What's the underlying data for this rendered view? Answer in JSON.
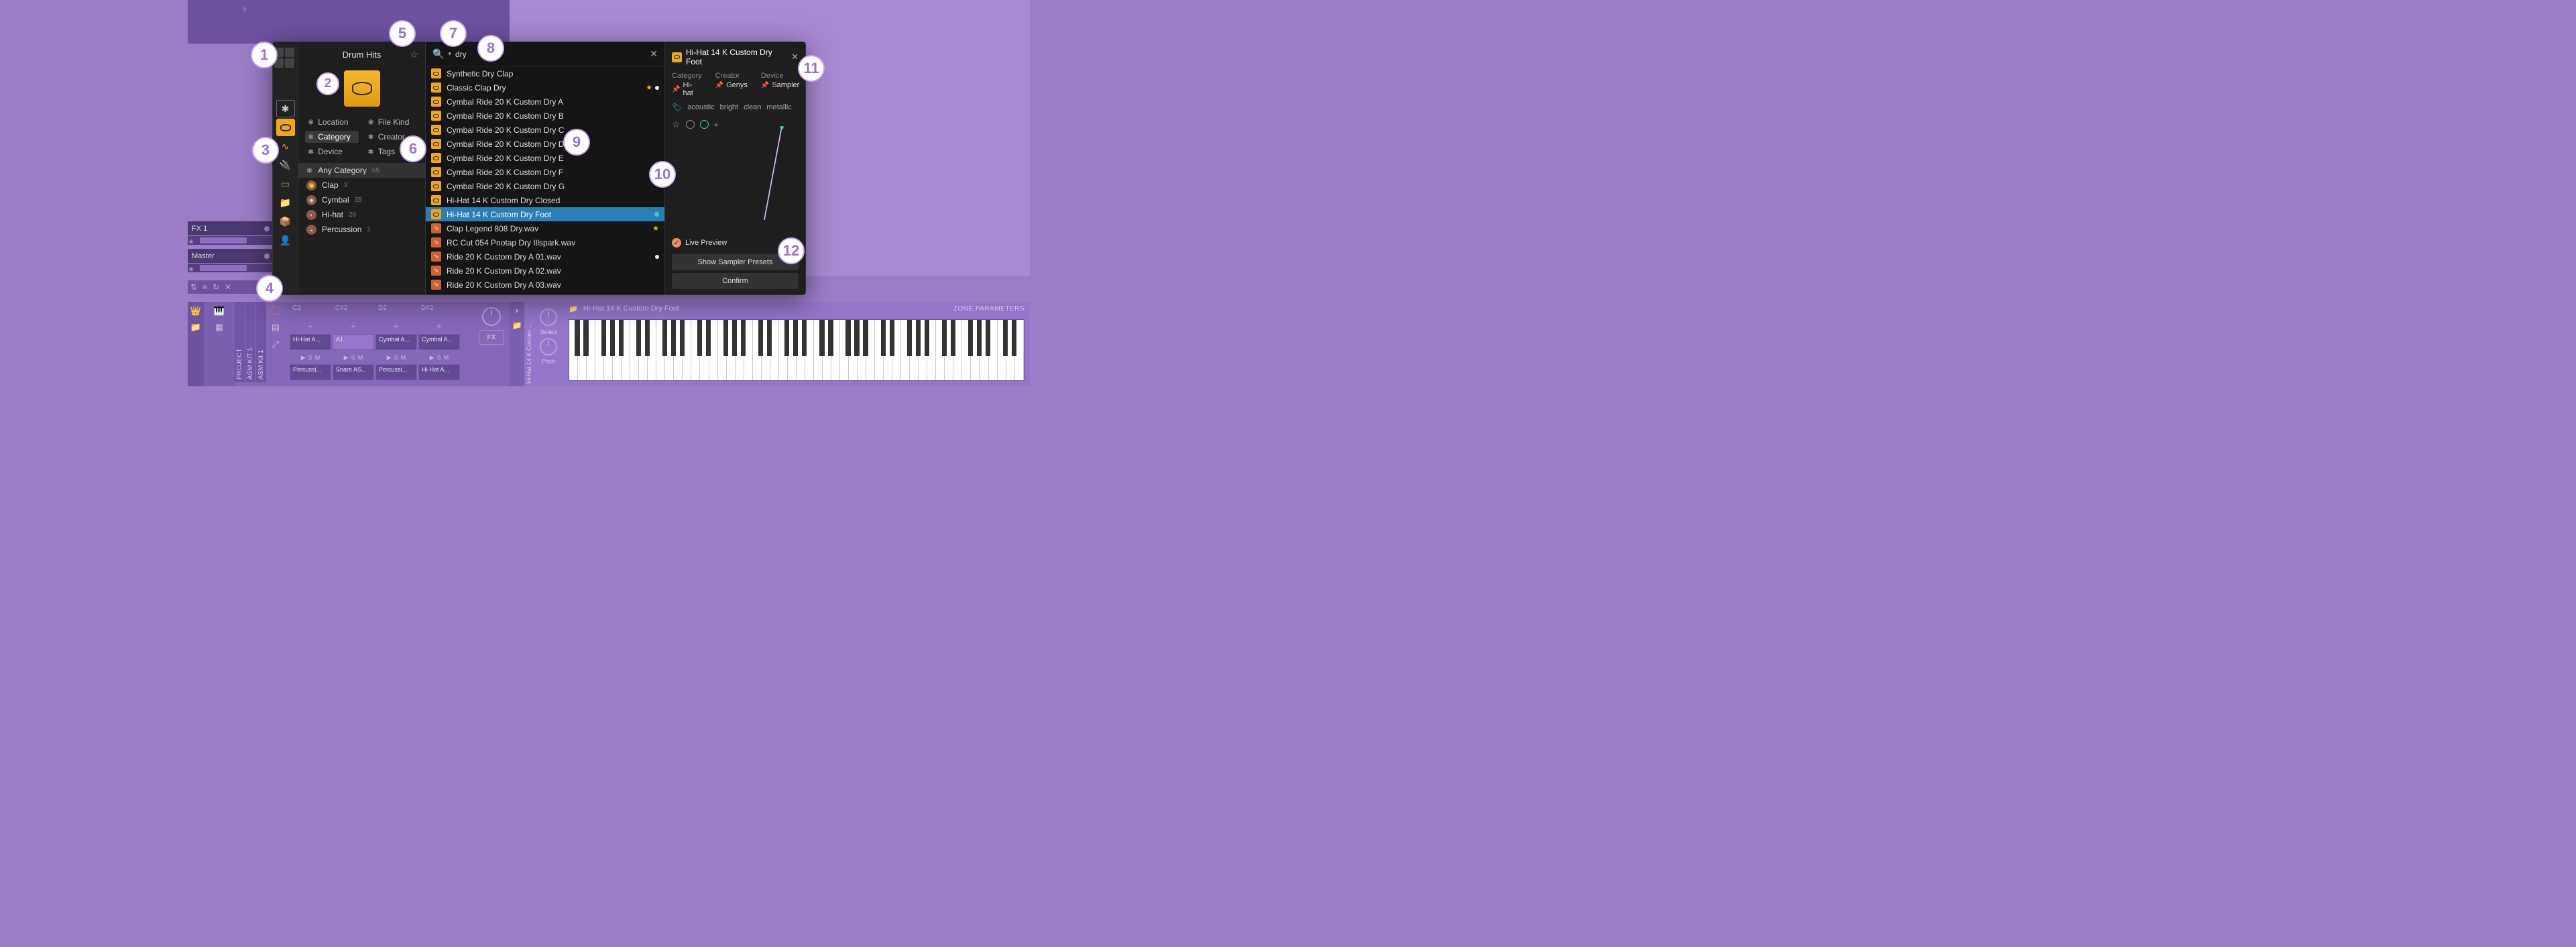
{
  "header": {
    "add_track_plus": "+"
  },
  "tracks": {
    "fx": {
      "name": "FX 1",
      "star": "★"
    },
    "master": {
      "name": "Master",
      "star": "★"
    }
  },
  "bottom_toolbar": {
    "icons": [
      "⇅",
      "≡",
      "↻",
      "✕"
    ],
    "chevron": "⌃"
  },
  "device_panel": {
    "vertical_labels": [
      "PROJECT",
      "ASM KIT 1",
      "ASM Kit 1"
    ],
    "power": "⏻",
    "pad_headers": [
      "C2",
      "C#2",
      "D2",
      "D#2"
    ],
    "pads_row1": [
      "Hi-Hat A...",
      "A1",
      "Cymbal A...",
      "Cymbal A..."
    ],
    "pads_row2": [
      "Percussi...",
      "Snare AS...",
      "Percussi...",
      "Hi-Hat A..."
    ],
    "pad_ctrl_play": "▶",
    "pad_ctrl_s": "S",
    "pad_ctrl_m": "M",
    "fx_label": "FX",
    "plus": "+"
  },
  "sampler": {
    "vlabel": "Hi-Hat 14 K Custom ...",
    "select_label": "Select",
    "pitch_label": "Pitch",
    "folder_icon": "📁",
    "file_name": "Hi-Hat 14 K Custom Dry Foot",
    "zone_params": "ZONE PARAMETERS",
    "half_moon": "◗"
  },
  "browser": {
    "title": "Drum Hits",
    "star": "☆",
    "strip_star": "✱",
    "filters": {
      "location": "Location",
      "file_kind": "File Kind",
      "category": "Category",
      "creator": "Creator",
      "device": "Device",
      "tags": "Tags"
    },
    "categories": {
      "any": "Any Category",
      "any_count": "65",
      "clap": "Clap",
      "clap_count": "3",
      "cymbal": "Cymbal",
      "cymbal_count": "35",
      "hihat": "Hi-hat",
      "hihat_count": "26",
      "percussion": "Percussion",
      "percussion_count": "1"
    },
    "search": {
      "value": "dry",
      "clear": "✕"
    },
    "results": [
      {
        "icon": "drum",
        "label": "Synthetic Dry Clap"
      },
      {
        "icon": "drum",
        "label": "Classic Clap Dry",
        "star": true,
        "dot": true
      },
      {
        "icon": "drum",
        "label": "Cymbal Ride 20 K Custom Dry A"
      },
      {
        "icon": "drum",
        "label": "Cymbal Ride 20 K Custom Dry B"
      },
      {
        "icon": "drum",
        "label": "Cymbal Ride 20 K Custom Dry C"
      },
      {
        "icon": "drum",
        "label": "Cymbal Ride 20 K Custom Dry D"
      },
      {
        "icon": "drum",
        "label": "Cymbal Ride 20 K Custom Dry E"
      },
      {
        "icon": "drum",
        "label": "Cymbal Ride 20 K Custom Dry F"
      },
      {
        "icon": "drum",
        "label": "Cymbal Ride 20 K Custom Dry G"
      },
      {
        "icon": "drum",
        "label": "Hi-Hat 14 K Custom Dry Closed"
      },
      {
        "icon": "drum",
        "label": "Hi-Hat 14 K Custom Dry Foot",
        "selected": true,
        "cyan": true
      },
      {
        "icon": "wav",
        "label": "Clap Legend 808 Dry.wav",
        "star": true
      },
      {
        "icon": "wav",
        "label": "RC Cut 054 Pnotap Dry Illspark.wav"
      },
      {
        "icon": "wav",
        "label": "Ride 20 K Custom Dry A 01.wav",
        "dot": true
      },
      {
        "icon": "wav",
        "label": "Ride 20 K Custom Dry A 02.wav"
      },
      {
        "icon": "wav",
        "label": "Ride 20 K Custom Dry A 03.wav"
      }
    ],
    "info": {
      "title": "Hi-Hat 14 K Custom Dry Foot",
      "close": "✕",
      "category_label": "Category",
      "category_value": "Hi-hat",
      "creator_label": "Creator",
      "creator_value": "Genys",
      "device_label": "Device",
      "device_value": "Sampler",
      "tags": [
        "acoustic",
        "bright",
        "clean",
        "metallic"
      ],
      "live_preview": "Live Preview",
      "show_presets": "Show Sampler Presets",
      "confirm": "Confirm",
      "plus": "+",
      "pin": "📌",
      "check": "✓"
    }
  },
  "callouts": {
    "1": "1",
    "2": "2",
    "3": "3",
    "4": "4",
    "5": "5",
    "6": "6",
    "7": "7",
    "8": "8",
    "9": "9",
    "10": "10",
    "11": "11",
    "12": "12"
  }
}
